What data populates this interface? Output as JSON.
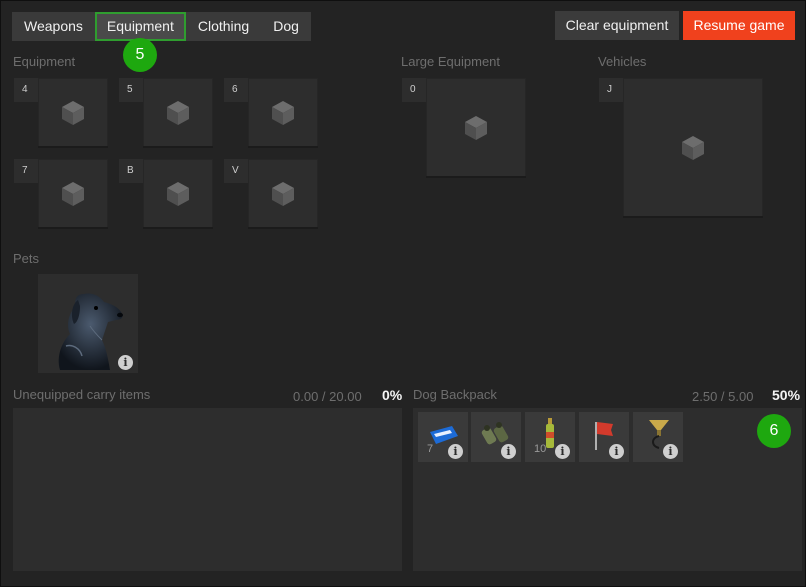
{
  "tabs": [
    {
      "label": "Weapons"
    },
    {
      "label": "Equipment"
    },
    {
      "label": "Clothing"
    },
    {
      "label": "Dog"
    }
  ],
  "buttons": {
    "clear": "Clear equipment",
    "resume": "Resume game"
  },
  "badges": {
    "tab_marker": "5",
    "backpack_marker": "6"
  },
  "colors": {
    "accent_green": "#1ea80f",
    "resume_red": "#f0411d",
    "active_tab_border": "#2f9d2f"
  },
  "sections": {
    "equipment": "Equipment",
    "large_equipment": "Large Equipment",
    "vehicles": "Vehicles",
    "pets": "Pets"
  },
  "equipment_slots": [
    {
      "key": "4",
      "icon": "cube-icon"
    },
    {
      "key": "5",
      "icon": "cube-icon"
    },
    {
      "key": "6",
      "icon": "cube-icon"
    },
    {
      "key": "7",
      "icon": "cube-icon"
    },
    {
      "key": "B",
      "icon": "cube-icon"
    },
    {
      "key": "V",
      "icon": "cube-icon"
    }
  ],
  "large_equipment_slot": {
    "key": "0",
    "icon": "cube-icon"
  },
  "vehicle_slot": {
    "key": "J",
    "icon": "cube-icon"
  },
  "pet": {
    "icon": "dog-portrait-icon",
    "info": "i"
  },
  "carry": {
    "label": "Unequipped carry items",
    "capacity": "0.00 / 20.00",
    "percent": "0%"
  },
  "backpack": {
    "label": "Dog Backpack",
    "capacity": "2.50 / 5.00",
    "percent": "50%",
    "items": [
      {
        "icon": "blue-card-icon",
        "count": "7",
        "info": "i"
      },
      {
        "icon": "binoculars-icon",
        "count": "",
        "info": "i"
      },
      {
        "icon": "bottle-icon",
        "count": "10",
        "info": "i"
      },
      {
        "icon": "red-flag-icon",
        "count": "",
        "info": "i"
      },
      {
        "icon": "funnel-lamp-icon",
        "count": "",
        "info": "i"
      }
    ]
  }
}
